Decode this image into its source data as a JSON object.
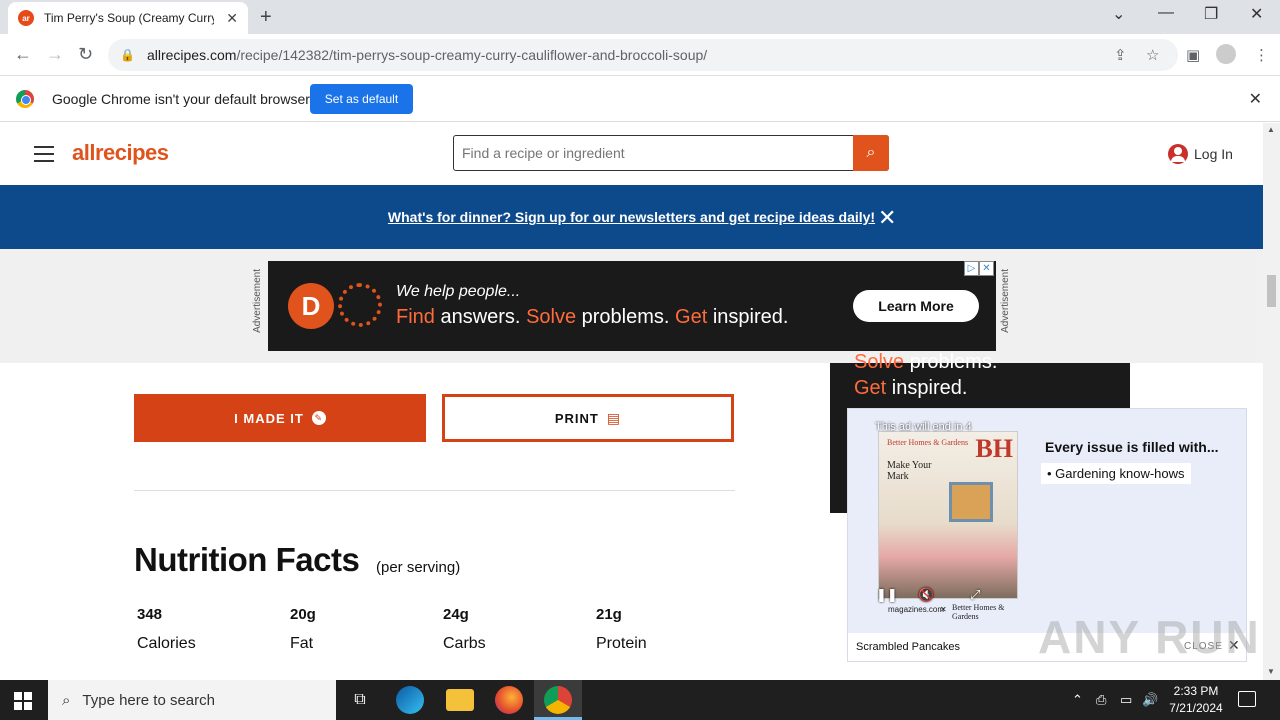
{
  "browser": {
    "tab_title": "Tim Perry's Soup (Creamy Curry",
    "tab_favicon_text": "ar",
    "url_domain": "allrecipes.com",
    "url_path": "/recipe/142382/tim-perrys-soup-creamy-curry-cauliflower-and-broccoli-soup/",
    "infobar_text": "Google Chrome isn't your default browser",
    "infobar_button": "Set as default"
  },
  "site": {
    "logo": "allrecipes",
    "search_placeholder": "Find a recipe or ingredient",
    "login_label": "Log In",
    "banner_text": "What's for dinner? Sign up for our newsletters and get recipe ideas daily!"
  },
  "ad_top": {
    "label": "Advertisement",
    "logo_letter": "D",
    "line1": "We help people...",
    "line2_w1": "Find",
    "line2_w2": " answers. ",
    "line2_w3": "Solve",
    "line2_w4": " problems. ",
    "line2_w5": "Get",
    "line2_w6": " inspired.",
    "cta": "Learn More"
  },
  "ad_side": {
    "line1_hl": "Solve",
    "line1_rest": " problems.",
    "line2_hl": "Get",
    "line2_rest": " inspired."
  },
  "recipe": {
    "made_it_label": "I MADE IT",
    "print_label": "PRINT",
    "nutrition_title": "Nutrition Facts",
    "nutrition_sub": "(per serving)",
    "nutrition": [
      {
        "value": "348",
        "label": "Calories"
      },
      {
        "value": "20g",
        "label": "Fat"
      },
      {
        "value": "24g",
        "label": "Carbs"
      },
      {
        "value": "21g",
        "label": "Protein"
      }
    ]
  },
  "popup": {
    "ad_end_text": "This ad will end in 4",
    "mag_brand": "BH",
    "mag_tag": "Better Homes & Gardens",
    "mag_title": "Make Your Mark",
    "logo_left": "magazines.com",
    "logo_right": "Better Homes & Gardens",
    "headline": "Every issue is filled with...",
    "bullet": "• Gardening know-hows",
    "footer_title": "Scrambled Pancakes",
    "close_label": "CLOSE"
  },
  "watermark": "ANY RUN",
  "taskbar": {
    "search_placeholder": "Type here to search",
    "time": "2:33 PM",
    "date": "7/21/2024"
  }
}
